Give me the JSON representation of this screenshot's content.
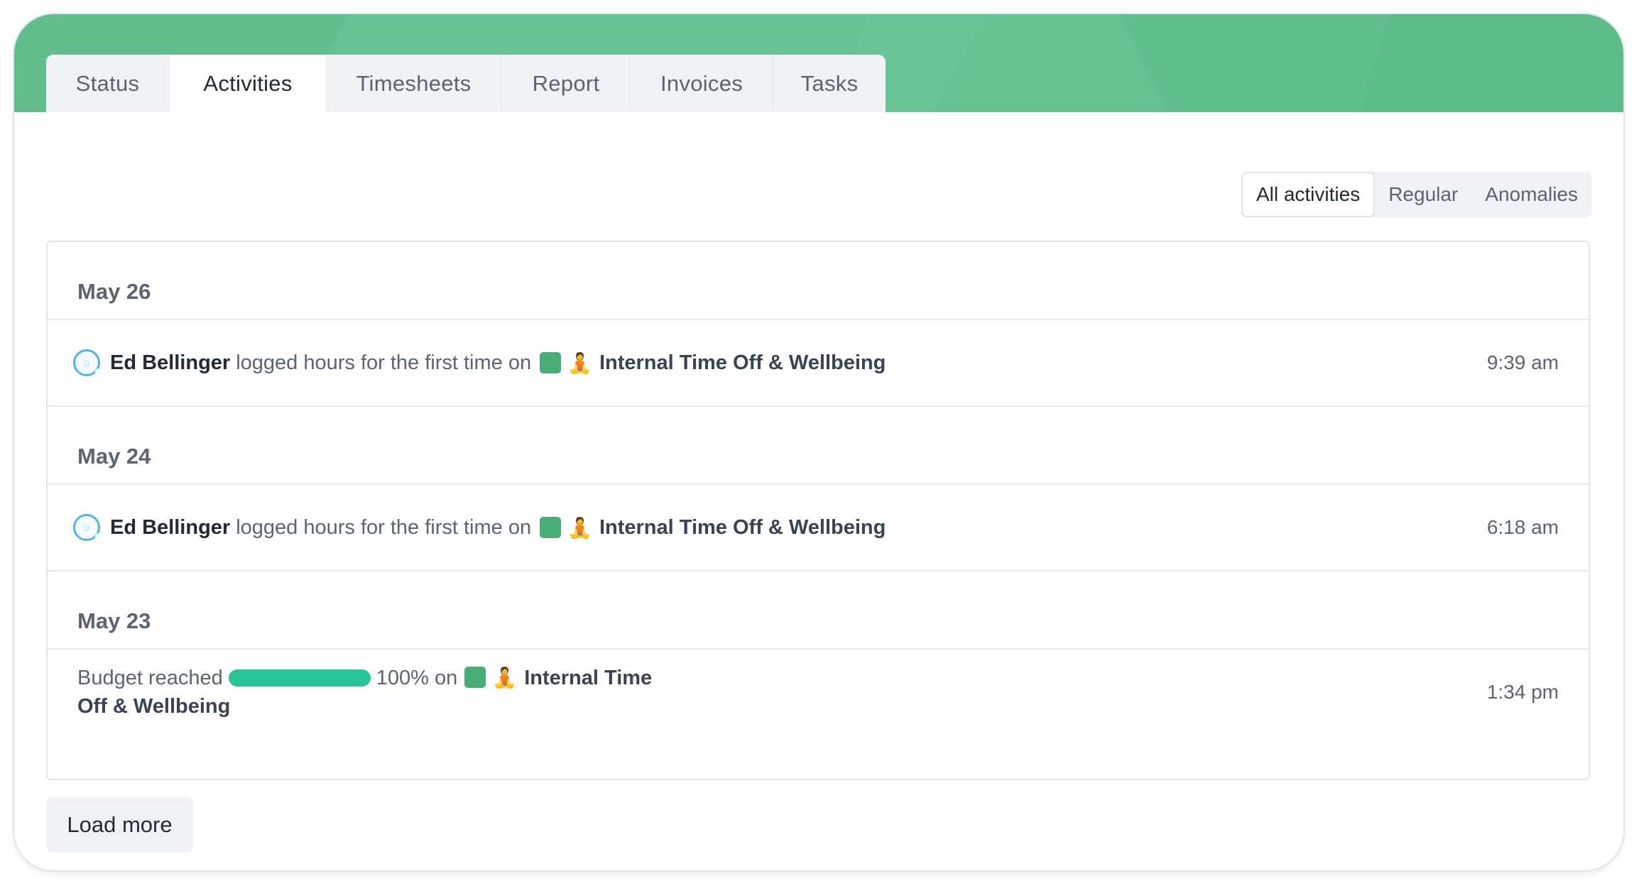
{
  "tabs": [
    {
      "label": "Status"
    },
    {
      "label": "Activities",
      "active": true
    },
    {
      "label": "Timesheets"
    },
    {
      "label": "Report"
    },
    {
      "label": "Invoices"
    },
    {
      "label": "Tasks"
    }
  ],
  "filters": [
    {
      "label": "All activities",
      "active": true
    },
    {
      "label": "Regular"
    },
    {
      "label": "Anomalies"
    }
  ],
  "colors": {
    "header": "#62bd8d",
    "project": "#4aad78",
    "budget_bar": "#27c495",
    "avatar_ring": "#4fb6dc"
  },
  "feed": {
    "groups": [
      {
        "date": "May 26",
        "person": "Ed Bellinger",
        "action": "logged hours for the first time on",
        "project_icon": "person-in-lotus-position-icon",
        "project": "Internal Time Off & Wellbeing",
        "time": "9:39 am"
      },
      {
        "date": "May 24",
        "person": "Ed Bellinger",
        "action": "logged hours for the first time on",
        "project_icon": "person-in-lotus-position-icon",
        "project": "Internal Time Off & Wellbeing",
        "time": "6:18 am"
      },
      {
        "date": "May 23",
        "budget_text": "Budget reached",
        "budget_progress": 1.0,
        "budget_percent": "100% on",
        "project_icon": "person-in-lotus-position-icon",
        "project": "Internal Time Off & Wellbeing",
        "time": "1:34 pm"
      }
    ]
  },
  "load_more_label": "Load more"
}
